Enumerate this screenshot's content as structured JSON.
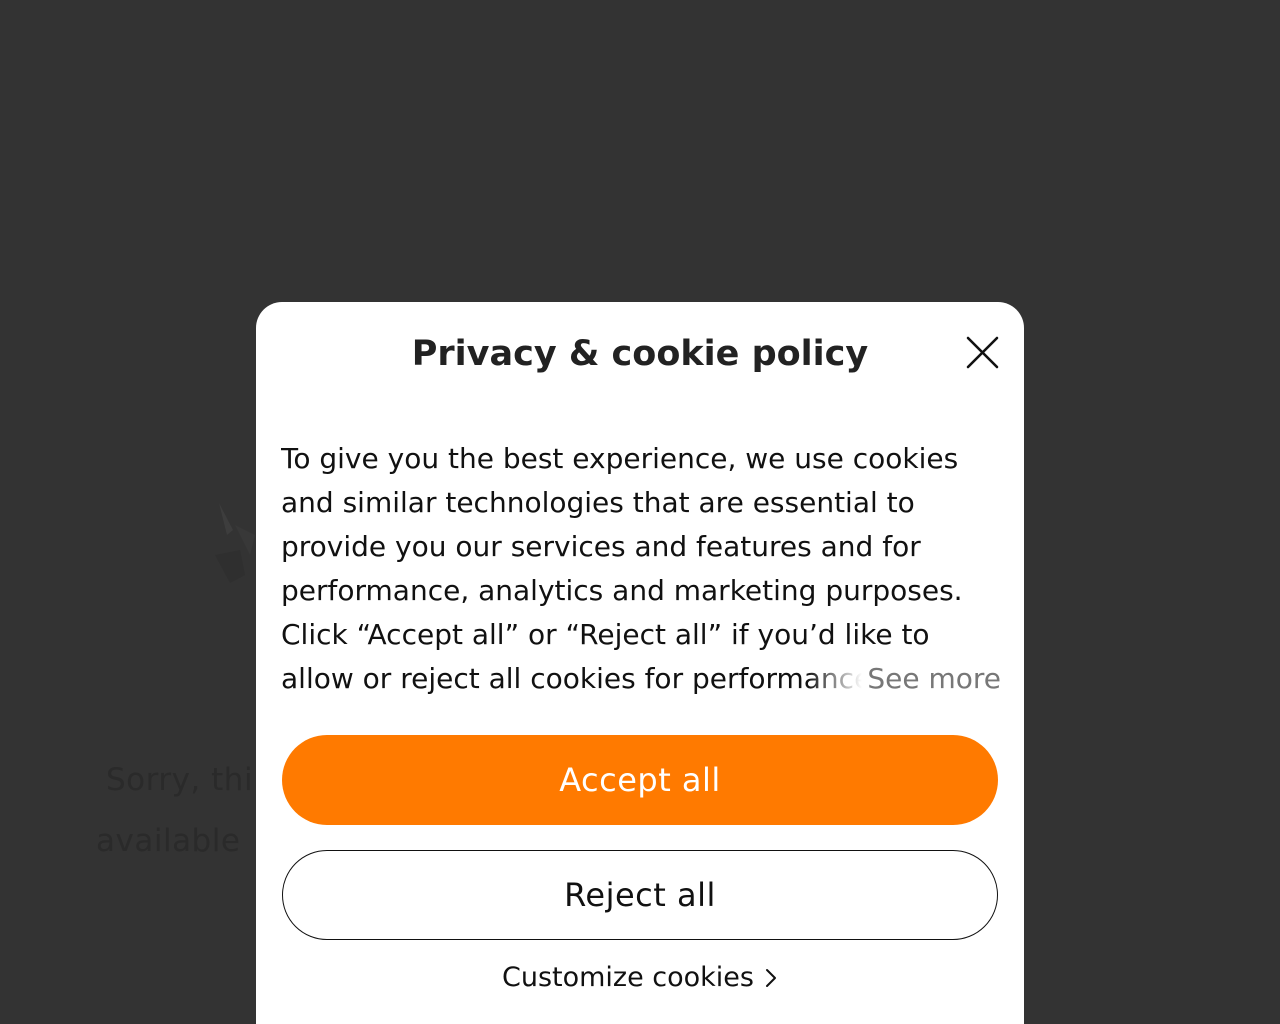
{
  "background": {
    "line1": "Sorry, thi",
    "line2": "available"
  },
  "modal": {
    "title": "Privacy & cookie policy",
    "close_icon": "close-icon",
    "body": "To give you the best experience, we use cookies and similar technologies that are essential to provide you our services and features and for performance, analytics and marketing purposes. Click “Accept all” or “Reject all” if you’d like to allow or reject all cookies for performance, analytics and marketing purposes.",
    "see_more": "See more",
    "accept_label": "Accept all",
    "reject_label": "Reject all",
    "customize_label": "Customize cookies",
    "customize_icon": "chevron-right-icon"
  },
  "colors": {
    "overlay": "#333333",
    "accent": "#ff7a00",
    "modal_bg": "#ffffff"
  }
}
